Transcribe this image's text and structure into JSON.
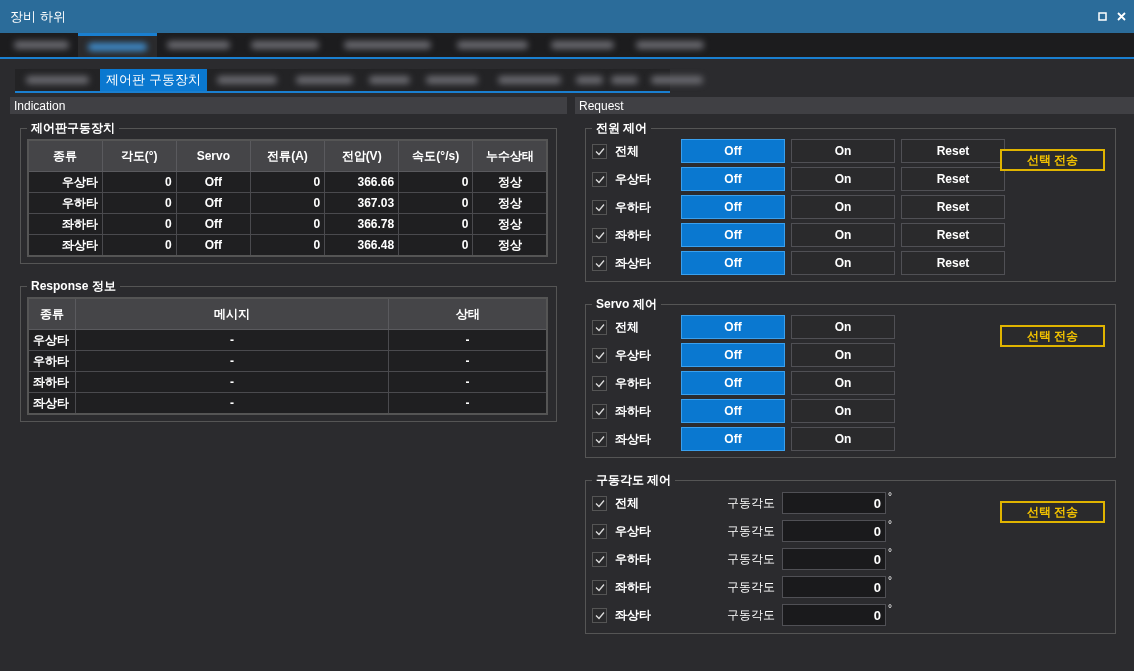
{
  "window": {
    "title": "장비 하위"
  },
  "top_tabs": [
    {
      "selected": false
    },
    {
      "selected": true
    },
    {
      "selected": false
    },
    {
      "selected": false
    },
    {
      "selected": false
    },
    {
      "selected": false
    },
    {
      "selected": false
    },
    {
      "selected": false
    }
  ],
  "sub_tabs": [
    {
      "selected": false
    },
    {
      "label": "제어판 구동장치",
      "selected": true
    },
    {
      "selected": false
    },
    {
      "selected": false
    },
    {
      "selected": false
    },
    {
      "selected": false
    },
    {
      "selected": false
    },
    {
      "selected": false
    },
    {
      "selected": false
    },
    {
      "selected": false
    }
  ],
  "indication": {
    "title": "Indication",
    "drive_group": {
      "title": "제어판구동장치",
      "columns": [
        "종류",
        "각도(°)",
        "Servo",
        "전류(A)",
        "전압(V)",
        "속도(°/s)",
        "누수상태"
      ],
      "rows": [
        [
          "우상타",
          "0",
          "Off",
          "0",
          "366.66",
          "0",
          "정상"
        ],
        [
          "우하타",
          "0",
          "Off",
          "0",
          "367.03",
          "0",
          "정상"
        ],
        [
          "좌하타",
          "0",
          "Off",
          "0",
          "366.78",
          "0",
          "정상"
        ],
        [
          "좌상타",
          "0",
          "Off",
          "0",
          "366.48",
          "0",
          "정상"
        ]
      ]
    },
    "response_group": {
      "title": "Response 정보",
      "columns": [
        "종류",
        "메시지",
        "상태"
      ],
      "rows": [
        [
          "우상타",
          "-",
          "-"
        ],
        [
          "우하타",
          "-",
          "-"
        ],
        [
          "좌하타",
          "-",
          "-"
        ],
        [
          "좌상타",
          "-",
          "-"
        ]
      ]
    }
  },
  "request": {
    "title": "Request",
    "power": {
      "title": "전원 제어",
      "send_button": "선택 전송",
      "rows": [
        {
          "label": "전체",
          "checked": true,
          "buttons": [
            {
              "label": "Off",
              "selected": true
            },
            {
              "label": "On",
              "selected": false
            },
            {
              "label": "Reset",
              "selected": false
            }
          ]
        },
        {
          "label": "우상타",
          "checked": true,
          "buttons": [
            {
              "label": "Off",
              "selected": true
            },
            {
              "label": "On",
              "selected": false
            },
            {
              "label": "Reset",
              "selected": false
            }
          ]
        },
        {
          "label": "우하타",
          "checked": true,
          "buttons": [
            {
              "label": "Off",
              "selected": true
            },
            {
              "label": "On",
              "selected": false
            },
            {
              "label": "Reset",
              "selected": false
            }
          ]
        },
        {
          "label": "좌하타",
          "checked": true,
          "buttons": [
            {
              "label": "Off",
              "selected": true
            },
            {
              "label": "On",
              "selected": false
            },
            {
              "label": "Reset",
              "selected": false
            }
          ]
        },
        {
          "label": "좌상타",
          "checked": true,
          "buttons": [
            {
              "label": "Off",
              "selected": true
            },
            {
              "label": "On",
              "selected": false
            },
            {
              "label": "Reset",
              "selected": false
            }
          ]
        }
      ]
    },
    "servo": {
      "title": "Servo 제어",
      "send_button": "선택 전송",
      "rows": [
        {
          "label": "전체",
          "checked": true,
          "buttons": [
            {
              "label": "Off",
              "selected": true
            },
            {
              "label": "On",
              "selected": false
            }
          ]
        },
        {
          "label": "우상타",
          "checked": true,
          "buttons": [
            {
              "label": "Off",
              "selected": true
            },
            {
              "label": "On",
              "selected": false
            }
          ]
        },
        {
          "label": "우하타",
          "checked": true,
          "buttons": [
            {
              "label": "Off",
              "selected": true
            },
            {
              "label": "On",
              "selected": false
            }
          ]
        },
        {
          "label": "좌하타",
          "checked": true,
          "buttons": [
            {
              "label": "Off",
              "selected": true
            },
            {
              "label": "On",
              "selected": false
            }
          ]
        },
        {
          "label": "좌상타",
          "checked": true,
          "buttons": [
            {
              "label": "Off",
              "selected": true
            },
            {
              "label": "On",
              "selected": false
            }
          ]
        }
      ]
    },
    "angle": {
      "title": "구동각도 제어",
      "send_button": "선택 전송",
      "rows": [
        {
          "label": "전체",
          "checked": true,
          "field_label": "구동각도",
          "value": "0",
          "unit": "°"
        },
        {
          "label": "우상타",
          "checked": true,
          "field_label": "구동각도",
          "value": "0",
          "unit": "°"
        },
        {
          "label": "우하타",
          "checked": true,
          "field_label": "구동각도",
          "value": "0",
          "unit": "°"
        },
        {
          "label": "좌하타",
          "checked": true,
          "field_label": "구동각도",
          "value": "0",
          "unit": "°"
        },
        {
          "label": "좌상타",
          "checked": true,
          "field_label": "구동각도",
          "value": "0",
          "unit": "°"
        }
      ]
    }
  }
}
